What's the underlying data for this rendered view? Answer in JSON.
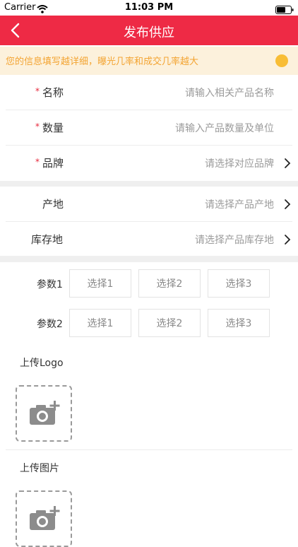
{
  "status_bar": {
    "carrier": "Carrier",
    "time": "11:03 PM"
  },
  "nav": {
    "title": "发布供应",
    "back_icon": "chevron-left-icon"
  },
  "notice": {
    "text": "您的信息填写越详细，曝光几率和成交几率越大",
    "accent": "#f8bd35"
  },
  "form": {
    "required_mark": "*",
    "name": {
      "label": "名称",
      "placeholder": "请输入相关产品名称"
    },
    "quantity": {
      "label": "数量",
      "placeholder": "请输入产品数量及单位"
    },
    "brand": {
      "label": "品牌",
      "value": "请选择对应品牌"
    },
    "origin": {
      "label": "产地",
      "value": "请选择产品产地"
    },
    "stock_location": {
      "label": "库存地",
      "value": "请选择产品库存地"
    }
  },
  "params": [
    {
      "label": "参数1",
      "options": [
        "选择1",
        "选择2",
        "选择3"
      ]
    },
    {
      "label": "参数2",
      "options": [
        "选择1",
        "选择2",
        "选择3"
      ]
    }
  ],
  "uploads": {
    "logo_title": "上传Logo",
    "image_title": "上传图片",
    "icon": "camera-add-icon"
  },
  "colors": {
    "brand": "#ee2a45",
    "notice_text": "#f3a432",
    "required": "#e6283c"
  }
}
